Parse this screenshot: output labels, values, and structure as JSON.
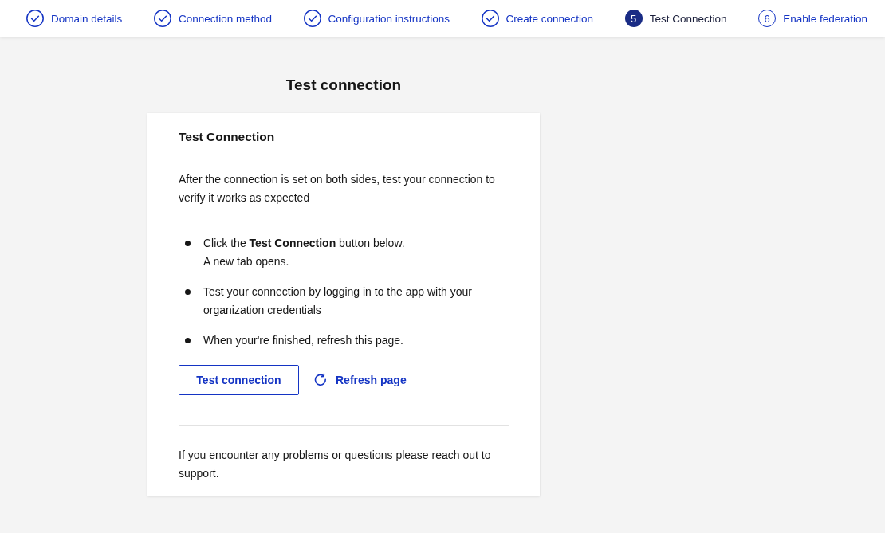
{
  "steps": [
    {
      "label": "Domain details",
      "completed": true,
      "selected": false
    },
    {
      "label": "Connection method",
      "completed": true,
      "selected": false
    },
    {
      "label": "Configuration instructions",
      "completed": true,
      "selected": false
    },
    {
      "label": "Create connection",
      "completed": true,
      "selected": false
    },
    {
      "label": "Test Connection",
      "completed": false,
      "selected": true,
      "number": "5"
    },
    {
      "label": "Enable federation",
      "completed": false,
      "selected": false,
      "number": "6"
    }
  ],
  "page_title": "Test connection",
  "card": {
    "heading": "Test Connection",
    "intro": "After the connection is set on both sides, test your connection to verify it works as expected",
    "instructions": [
      {
        "lines": [
          "Click the **Test Connection** button below.",
          "A new tab opens."
        ]
      },
      {
        "lines": [
          "Test your connection by logging in to the app with your organization credentials"
        ]
      },
      {
        "lines": [
          "When your're finished, refresh this page."
        ]
      }
    ],
    "test_button": "Test connection",
    "refresh_link": "Refresh page",
    "footer": "If you encounter any problems or questions please reach out to support."
  }
}
